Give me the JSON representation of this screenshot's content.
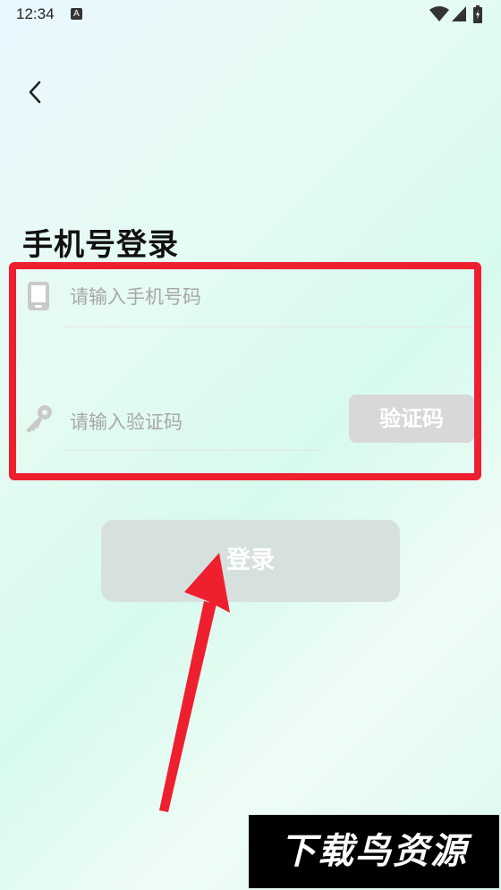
{
  "status_bar": {
    "time": "12:34",
    "notification_icon": "A"
  },
  "page": {
    "title": "手机号登录"
  },
  "form": {
    "phone_placeholder": "请输入手机号码",
    "code_placeholder": "请输入验证码",
    "get_code_label": "验证码",
    "login_label": "登录"
  },
  "icons": [
    "back-arrow-icon",
    "phone-icon",
    "key-icon",
    "wifi-icon",
    "signal-icon",
    "battery-icon"
  ],
  "annotation": {
    "highlight_color": "#ee2030"
  },
  "watermark": {
    "text": "下载鸟资源"
  }
}
